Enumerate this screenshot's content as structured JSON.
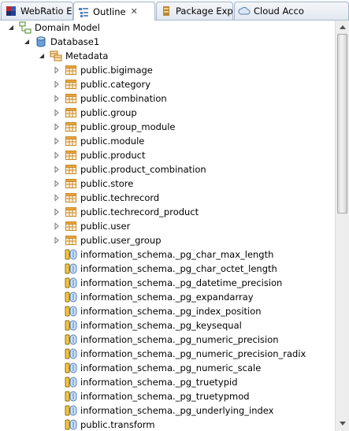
{
  "tabs": [
    {
      "label": "WebRatio Ex",
      "icon": "webratio-icon",
      "active": false
    },
    {
      "label": "Outline",
      "icon": "outline-icon",
      "active": true,
      "close": "✕"
    },
    {
      "label": "Package Exp",
      "icon": "package-explorer-icon",
      "active": false
    },
    {
      "label": "Cloud Acco",
      "icon": "cloud-icon",
      "active": false
    }
  ],
  "tree": {
    "root": {
      "label": "Domain Model",
      "icon": "domain-model-icon",
      "expanded": true
    },
    "database": {
      "label": "Database1",
      "icon": "database-icon",
      "expanded": true
    },
    "metadata": {
      "label": "Metadata",
      "icon": "metadata-icon",
      "expanded": true
    },
    "tables": [
      "public.bigimage",
      "public.category",
      "public.combination",
      "public.group",
      "public.group_module",
      "public.module",
      "public.product",
      "public.product_combination",
      "public.store",
      "public.techrecord",
      "public.techrecord_product",
      "public.user",
      "public.user_group"
    ],
    "functions": [
      "information_schema._pg_char_max_length",
      "information_schema._pg_char_octet_length",
      "information_schema._pg_datetime_precision",
      "information_schema._pg_expandarray",
      "information_schema._pg_index_position",
      "information_schema._pg_keysequal",
      "information_schema._pg_numeric_precision",
      "information_schema._pg_numeric_precision_radix",
      "information_schema._pg_numeric_scale",
      "information_schema._pg_truetypid",
      "information_schema._pg_truetypmod",
      "information_schema._pg_underlying_index",
      "public.transform"
    ]
  },
  "colors": {
    "tab_border": "#a9b8cc",
    "table_icon": "#e8a33c",
    "function_icon": "#4a7fc1"
  }
}
